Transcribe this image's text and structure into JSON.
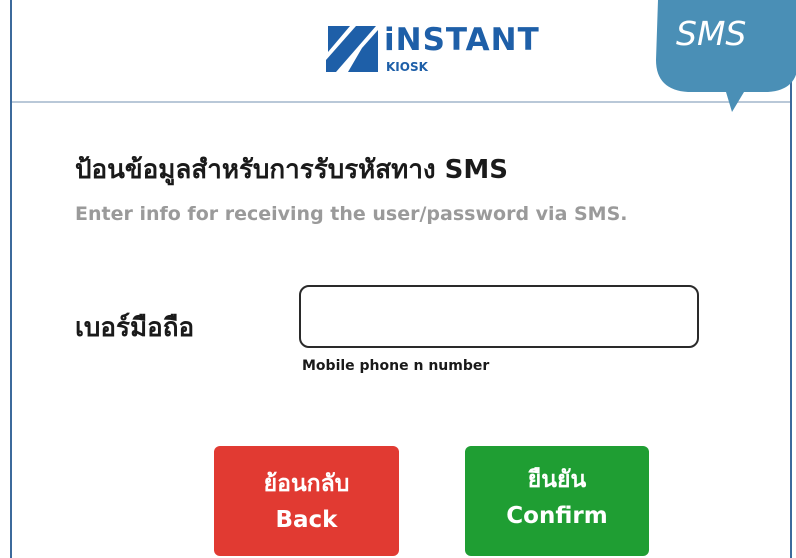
{
  "header": {
    "logo_brand": "iNSTANT",
    "logo_sub": "KIOSK",
    "badge_text": "SMS"
  },
  "form": {
    "title": "ป้อนข้อมูลสำหรับการรับรหัสทาง SMS",
    "subtitle": "Enter info for receiving the user/password via SMS.",
    "phone_label": "เบอร์มือถือ",
    "phone_value": "",
    "phone_hint": "Mobile phone n number"
  },
  "buttons": {
    "back_th": "ย้อนกลับ",
    "back_en": "Back",
    "confirm_th": "ยืนยัน",
    "confirm_en": "Confirm"
  },
  "colors": {
    "brand_blue": "#1e5fa8",
    "back_red": "#e13a32",
    "confirm_green": "#1f9e33",
    "bubble_blue": "#4a8fb6"
  },
  "icons": {
    "logo": "instant-kiosk-logo-icon",
    "badge": "speech-bubble-icon"
  }
}
